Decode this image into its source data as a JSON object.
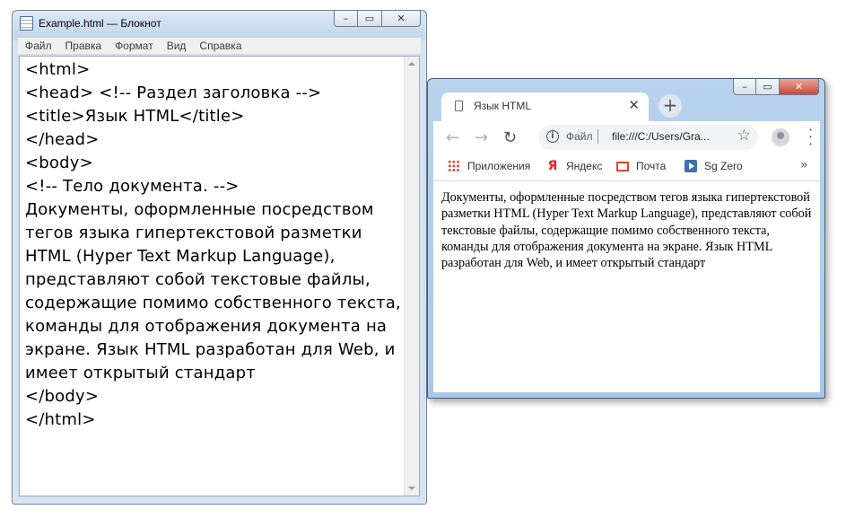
{
  "notepad": {
    "title": "Example.html — Блокнот",
    "menu": [
      "Файл",
      "Правка",
      "Формат",
      "Вид",
      "Справка"
    ],
    "content": "<html>\n<head> <!-- Раздел заголовка -->\n<title>Язык HTML</title>\n</head>\n<body>\n<!-- Тело документа. -->\nДокументы, оформленные посредством тегов языка гипертекстовой разметки HTML (Hyper Text Markup Language), представляют собой текстовые файлы, содержащие помимо собственного текста, команды для отображения документа на экране. Язык HTML разработан для Web, и имеет открытый стандарт\n</body>\n</html>"
  },
  "browser": {
    "tab_title": "Язык HTML",
    "scheme_label": "Файл",
    "url": "file:///C:/Users/Gra...",
    "bookmarks": [
      "Приложения",
      "Яндекс",
      "Почта",
      "Sg Zero"
    ],
    "page_text": "Документы, оформленные посредством тегов языка гипертекстовой разметки HTML (Hyper Text Markup Language), представляют собой текстовые файлы, содержащие помимо собственного текста, команды для отображения документа на экране. Язык HTML разработан для Web, и имеет открытый стандарт"
  },
  "icons": {
    "window_controls": [
      "minimize-icon",
      "maximize-icon",
      "close-icon"
    ],
    "toolbar": [
      "back-icon",
      "forward-icon",
      "reload-icon",
      "info-icon",
      "star-icon",
      "profile-icon",
      "menu-icon"
    ]
  }
}
